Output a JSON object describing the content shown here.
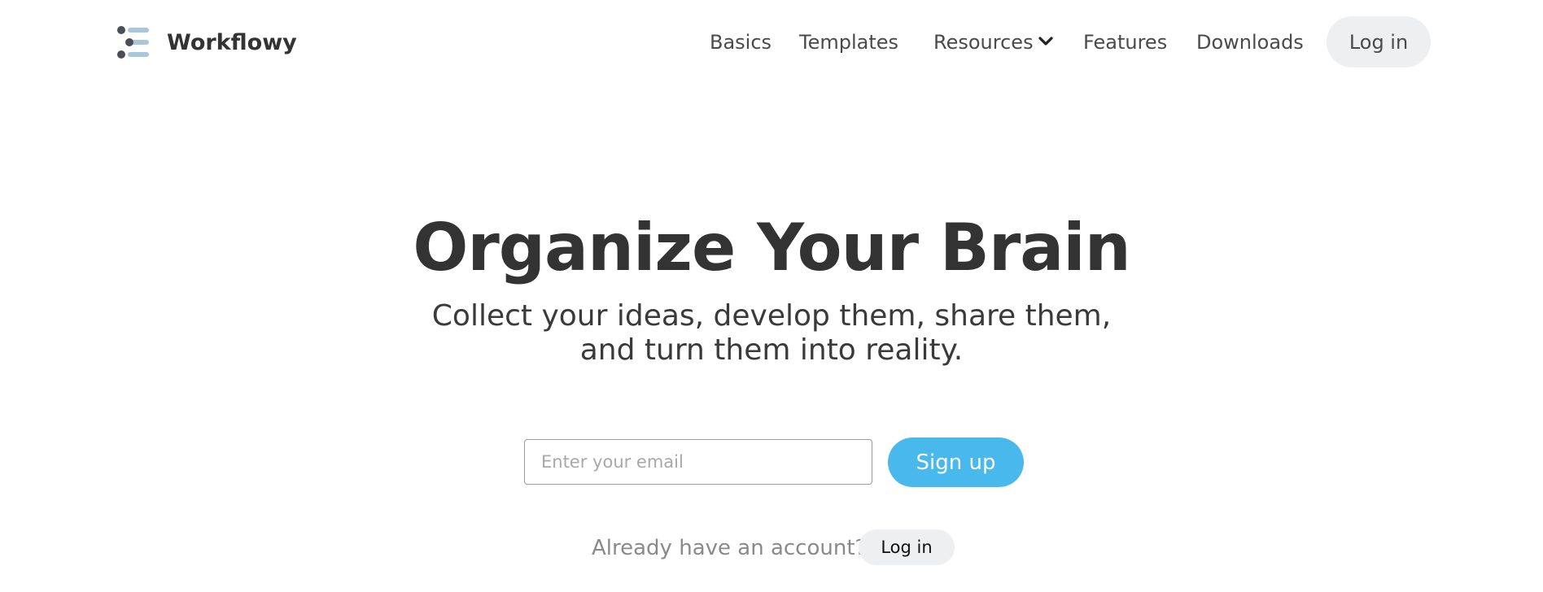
{
  "brand": {
    "name": "Workflowy",
    "logo_icon": "workflowy-list-logo-icon"
  },
  "nav": {
    "items": [
      {
        "label": "Basics"
      },
      {
        "label": "Templates"
      },
      {
        "label": "Resources",
        "icon": "chevron-down-icon"
      },
      {
        "label": "Features"
      },
      {
        "label": "Downloads"
      }
    ],
    "login_label": "Log in"
  },
  "hero": {
    "title": "Organize Your Brain",
    "subtitle_line1": "Collect your ideas, develop them, share them,",
    "subtitle_line2": "and turn them into reality."
  },
  "signup": {
    "email_placeholder": "Enter your email",
    "button_label": "Sign up"
  },
  "account": {
    "prompt": "Already have an account?",
    "login_label": "Log in"
  },
  "colors": {
    "text_dark": "#333333",
    "signup_blue": "#49b8ec",
    "pill_gray": "#eeeff1",
    "logo_dot": "#4a4f57",
    "logo_bar": "#a9c6dc"
  }
}
